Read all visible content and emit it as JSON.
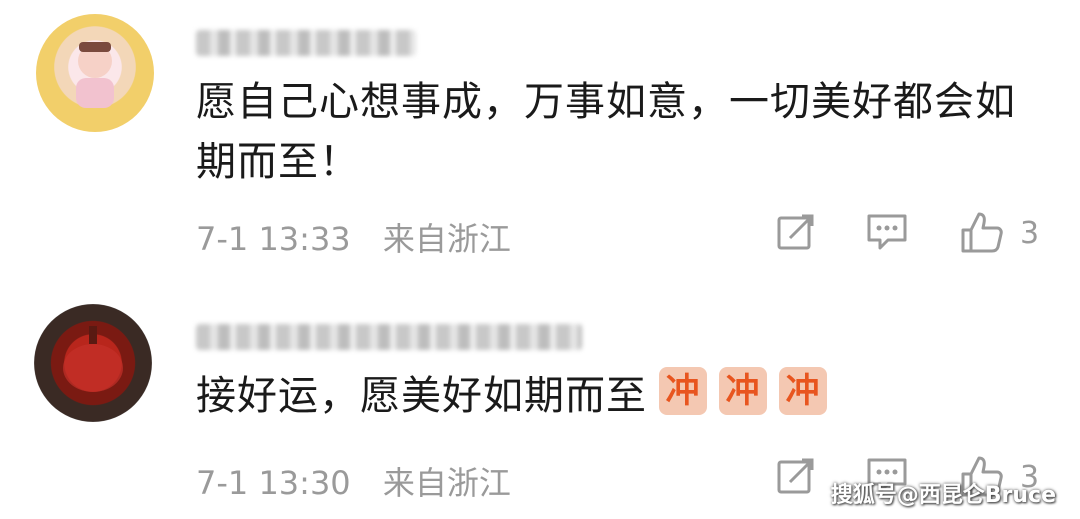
{
  "comments": [
    {
      "text_line1": "愿自己心想事成，万事如意，一切美好都会如",
      "text_line2": "期而至！",
      "date": "7-1 13:33",
      "location": "来自浙江",
      "likes": "3"
    },
    {
      "text": "接好运，愿美好如期而至",
      "emoji": [
        "冲",
        "冲",
        "冲"
      ],
      "date": "7-1 13:30",
      "location": "来自浙江",
      "likes": "3"
    }
  ],
  "watermark": "搜狐号@西昆仑Bruce",
  "icons": [
    "share-icon",
    "reply-icon",
    "like-icon"
  ],
  "colors": {
    "meta": "#9a9a9a",
    "text": "#1a1a1a",
    "emoji_bg": "#f4c8b2",
    "emoji_fg": "#e8551f"
  }
}
